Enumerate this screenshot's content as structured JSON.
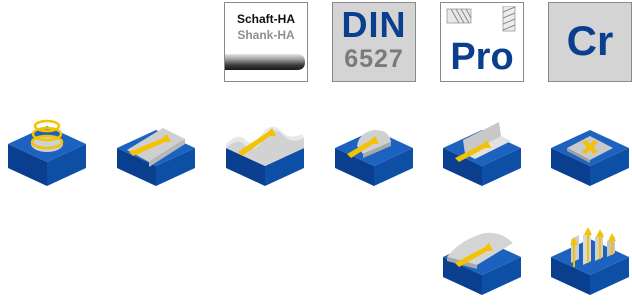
{
  "badges": {
    "shank": {
      "title": "Schaft-HA",
      "subtitle": "Shank-HA"
    },
    "din": {
      "line1": "DIN",
      "line2": "6527"
    },
    "pro": {
      "label": "Pro"
    },
    "cr": {
      "label": "Cr"
    }
  },
  "operation_icons": [
    "helical-plunging-icon",
    "face-milling-icon",
    "profile-milling-icon",
    "pocketing-icon",
    "shoulder-milling-icon",
    "plunge-milling-icon",
    "copy-milling-icon",
    "vertical-plunging-icon"
  ],
  "colors": {
    "icon_blue": "#0a3f8f",
    "icon_gray": "#c8c8c8",
    "arrow_yellow": "#f4c200",
    "badge_gray": "#d4d4d4",
    "text_gray": "#7a7a7a"
  }
}
